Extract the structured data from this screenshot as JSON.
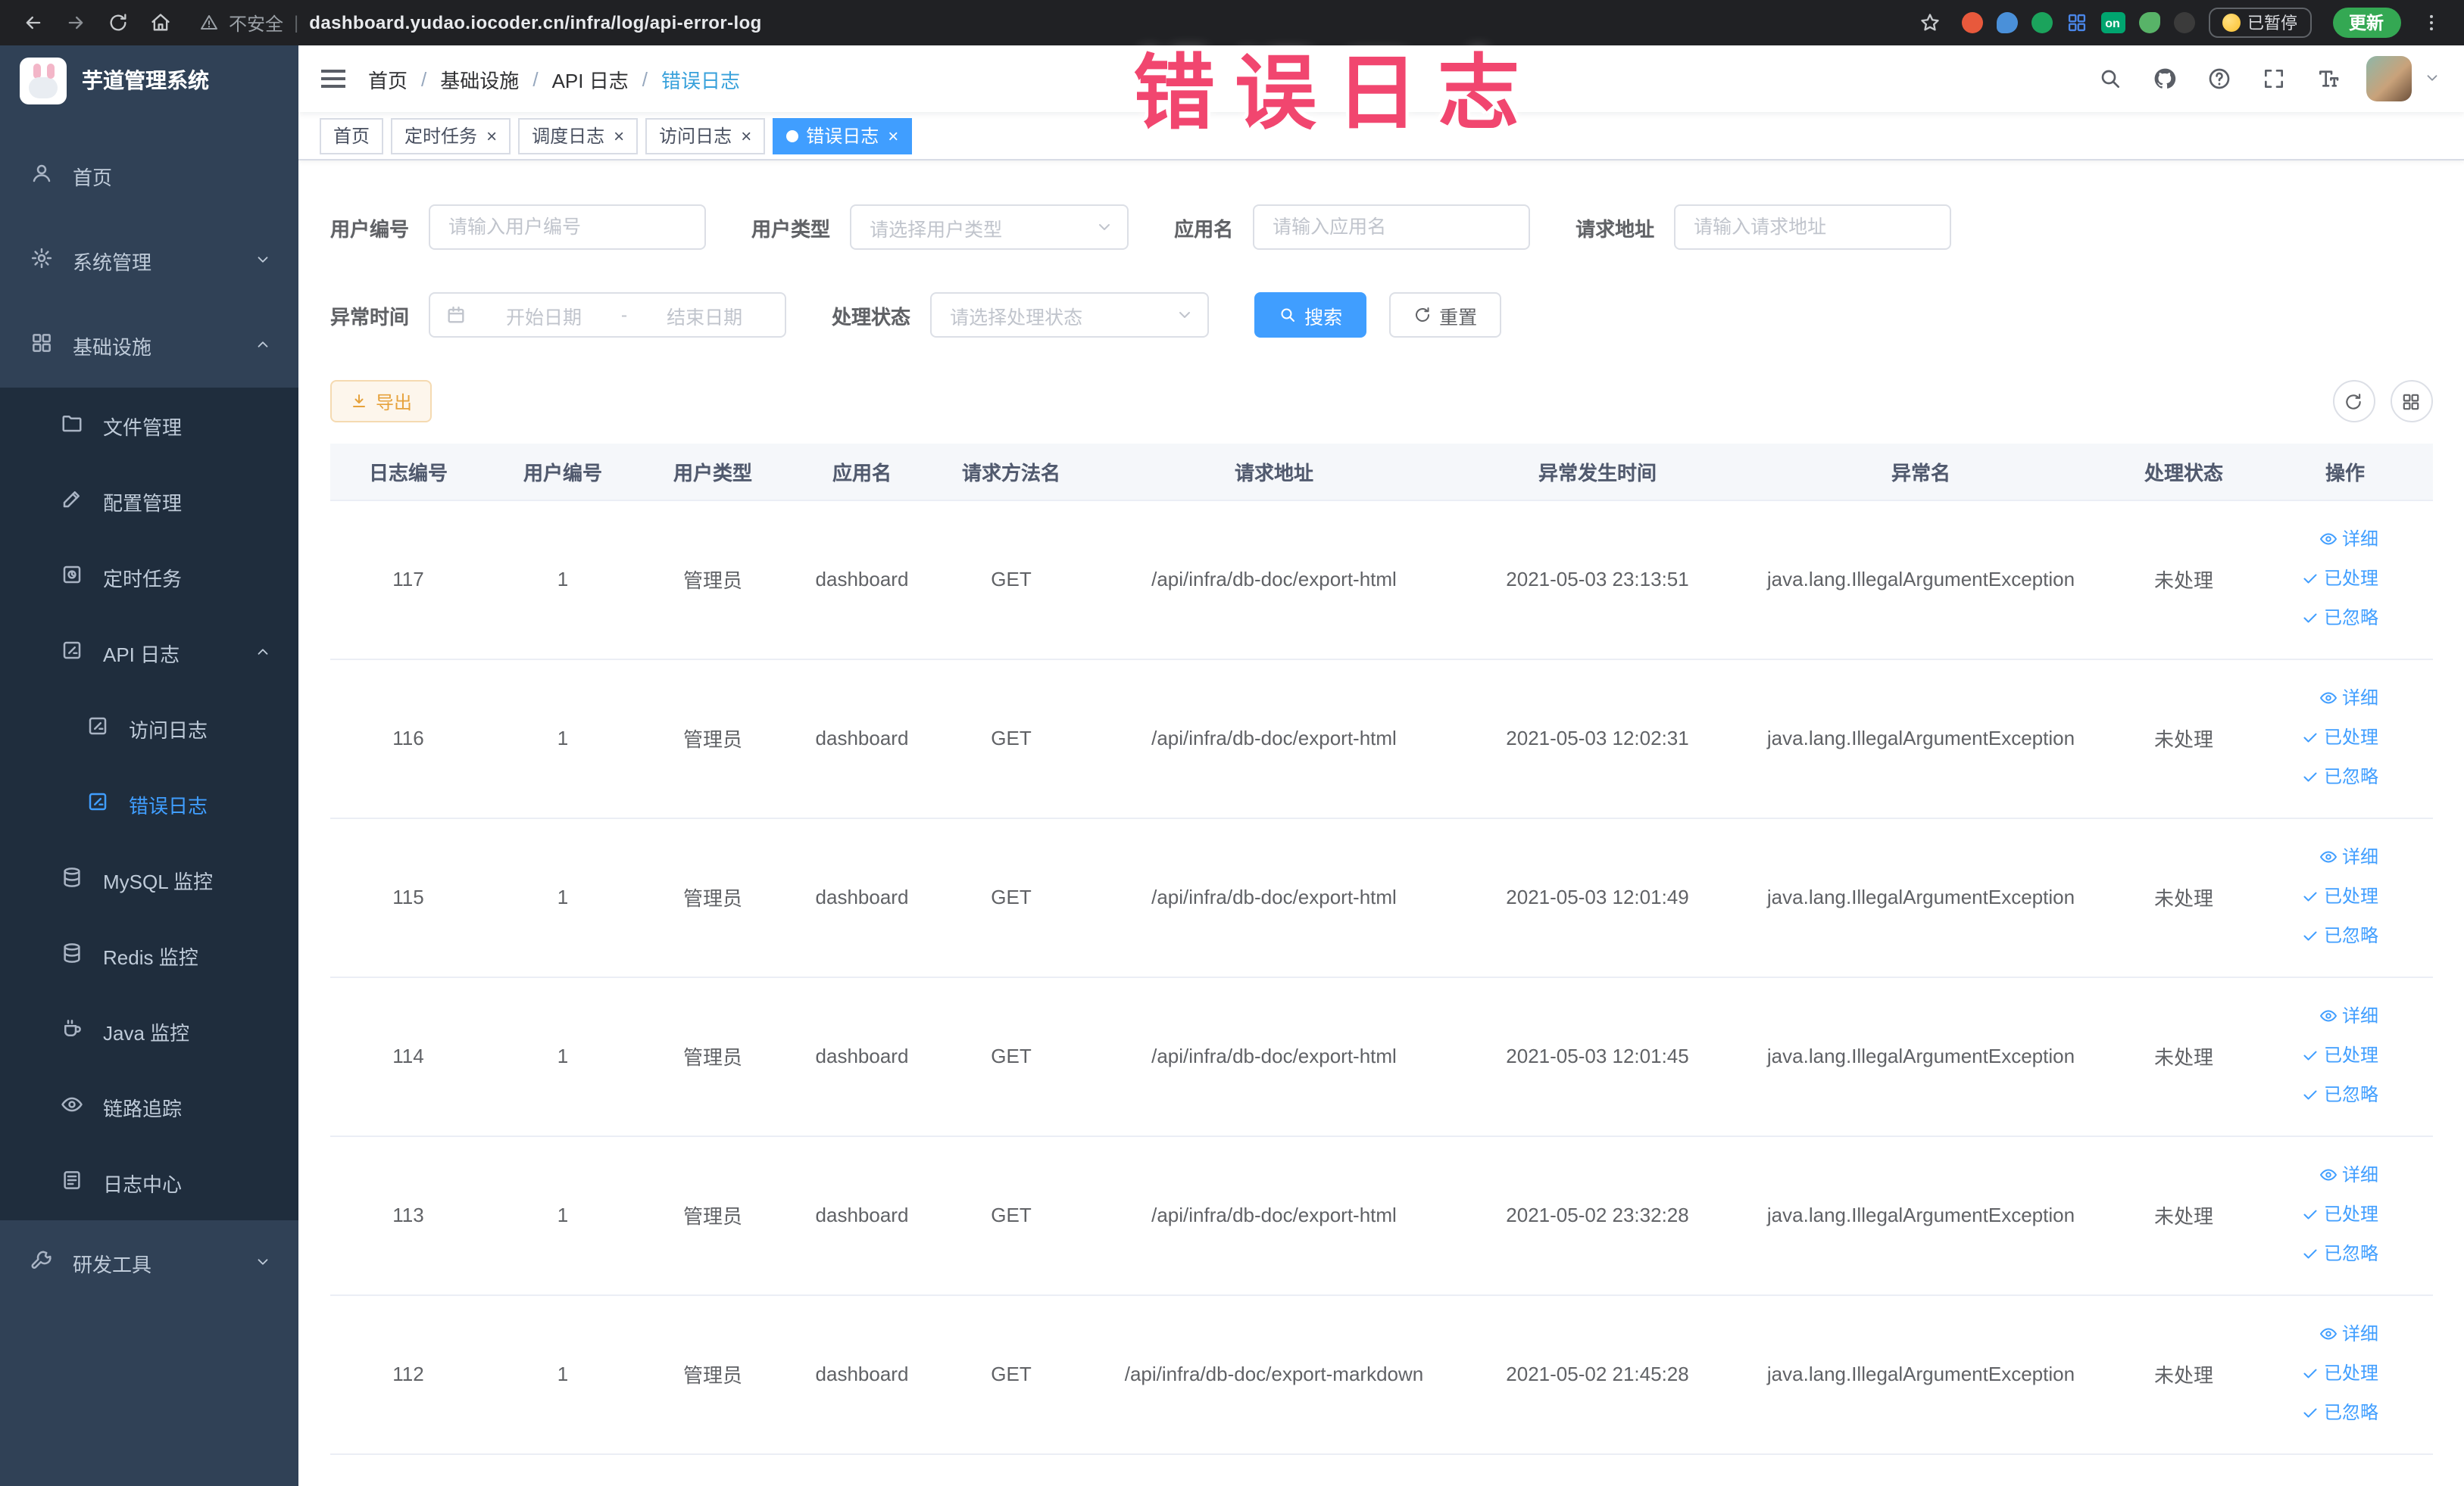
{
  "colors": {
    "primary": "#409EFF",
    "warning_button": "#E6A23C",
    "sidebar_bg": "#304156",
    "sidebar_submenu_bg": "#1F2D3D",
    "active_tab_bg": "#409EFF",
    "annotation": "#F1466F",
    "table_header_bg": "#F5F7FA"
  },
  "glyphs": {
    "close": "×",
    "pipe": "|"
  },
  "annotation": "错误日志",
  "browser": {
    "security": "不安全",
    "url": "dashboard.yudao.iocoder.cn/infra/log/api-error-log",
    "ext_on_badge": "on",
    "paused": "已暂停",
    "update": "更新"
  },
  "sidebar": {
    "title": "芋道管理系统",
    "items": {
      "home": "首页",
      "system": "系统管理",
      "infra": "基础设施",
      "file": "文件管理",
      "config": "配置管理",
      "job": "定时任务",
      "api_log": "API 日志",
      "access_log": "访问日志",
      "error_log": "错误日志",
      "mysql": "MySQL 监控",
      "redis": "Redis 监控",
      "java": "Java 监控",
      "trace": "链路追踪",
      "log_center": "日志中心",
      "devtools": "研发工具"
    }
  },
  "breadcrumb": {
    "separator": "/",
    "items": [
      "首页",
      "基础设施",
      "API 日志",
      "错误日志"
    ]
  },
  "tabs": [
    {
      "label": "首页"
    },
    {
      "label": "定时任务"
    },
    {
      "label": "调度日志"
    },
    {
      "label": "访问日志"
    },
    {
      "label": "错误日志"
    }
  ],
  "filters": {
    "user_id": {
      "label": "用户编号",
      "placeholder": "请输入用户编号"
    },
    "user_type": {
      "label": "用户类型",
      "placeholder": "请选择用户类型"
    },
    "app_name": {
      "label": "应用名",
      "placeholder": "请输入应用名"
    },
    "request_url": {
      "label": "请求地址",
      "placeholder": "请输入请求地址"
    },
    "exception_time": {
      "label": "异常时间",
      "start_placeholder": "开始日期",
      "separator": "-",
      "end_placeholder": "结束日期"
    },
    "process_status": {
      "label": "处理状态",
      "placeholder": "请选择处理状态"
    },
    "search": "搜索",
    "reset": "重置"
  },
  "toolbar": {
    "export": "导出"
  },
  "table": {
    "columns": [
      "日志编号",
      "用户编号",
      "用户类型",
      "应用名",
      "请求方法名",
      "请求地址",
      "异常发生时间",
      "异常名",
      "处理状态",
      "操作"
    ],
    "actions": {
      "detail": "详细",
      "processed": "已处理",
      "ignored": "已忽略"
    },
    "rows": [
      {
        "id": "117",
        "user_id": "1",
        "user_type": "管理员",
        "app": "dashboard",
        "method": "GET",
        "url": "/api/infra/db-doc/export-html",
        "time": "2021-05-03 23:13:51",
        "exception": "java.lang.IllegalArgumentException",
        "status": "未处理"
      },
      {
        "id": "116",
        "user_id": "1",
        "user_type": "管理员",
        "app": "dashboard",
        "method": "GET",
        "url": "/api/infra/db-doc/export-html",
        "time": "2021-05-03 12:02:31",
        "exception": "java.lang.IllegalArgumentException",
        "status": "未处理"
      },
      {
        "id": "115",
        "user_id": "1",
        "user_type": "管理员",
        "app": "dashboard",
        "method": "GET",
        "url": "/api/infra/db-doc/export-html",
        "time": "2021-05-03 12:01:49",
        "exception": "java.lang.IllegalArgumentException",
        "status": "未处理"
      },
      {
        "id": "114",
        "user_id": "1",
        "user_type": "管理员",
        "app": "dashboard",
        "method": "GET",
        "url": "/api/infra/db-doc/export-html",
        "time": "2021-05-03 12:01:45",
        "exception": "java.lang.IllegalArgumentException",
        "status": "未处理"
      },
      {
        "id": "113",
        "user_id": "1",
        "user_type": "管理员",
        "app": "dashboard",
        "method": "GET",
        "url": "/api/infra/db-doc/export-html",
        "time": "2021-05-02 23:32:28",
        "exception": "java.lang.IllegalArgumentException",
        "status": "未处理"
      },
      {
        "id": "112",
        "user_id": "1",
        "user_type": "管理员",
        "app": "dashboard",
        "method": "GET",
        "url": "/api/infra/db-doc/export-markdown",
        "time": "2021-05-02 21:45:28",
        "exception": "java.lang.IllegalArgumentException",
        "status": "未处理"
      }
    ]
  }
}
